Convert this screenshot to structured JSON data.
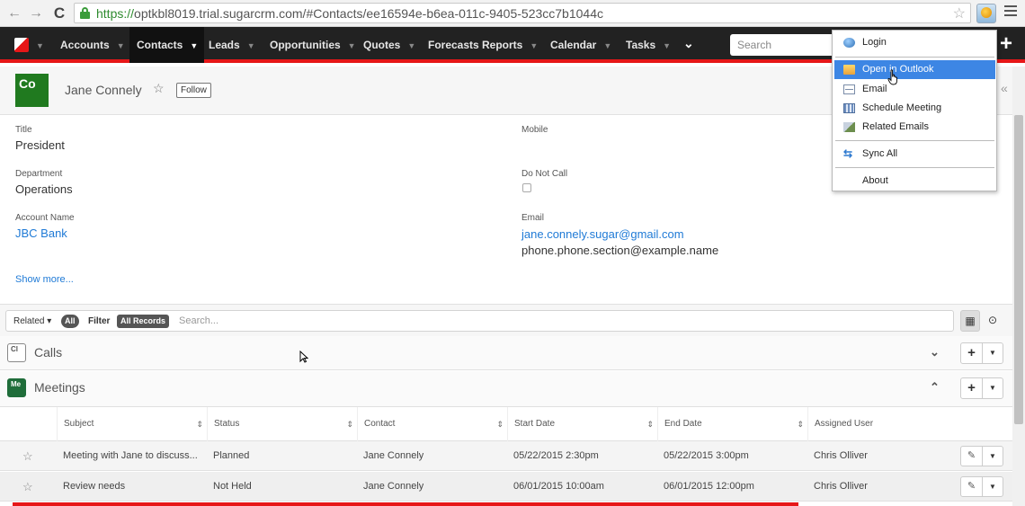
{
  "browser": {
    "url_scheme": "https://",
    "url_rest": "optkbl8019.trial.sugarcrm.com/#Contacts/ee16594e-b6ea-011c-9405-523cc7b1044c",
    "back_glyph": "←",
    "forward_glyph": "→",
    "reload_glyph": "C",
    "star_glyph": "☆"
  },
  "nav": {
    "items": [
      {
        "label": "Accounts"
      },
      {
        "label": "Contacts"
      },
      {
        "label": "Leads"
      },
      {
        "label": "Opportunities"
      },
      {
        "label": "Quotes"
      },
      {
        "label": "Forecasts"
      },
      {
        "label": "Reports"
      },
      {
        "label": "Calendar"
      },
      {
        "label": "Tasks"
      }
    ],
    "caret": "▼",
    "more": "⌄",
    "search_placeholder": "Search",
    "plus": "+"
  },
  "record": {
    "avatar": "Co",
    "name": "Jane Connely",
    "star": "☆",
    "follow": "Follow",
    "collapse": "«"
  },
  "fields": {
    "title_label": "Title",
    "title_value": "President",
    "mobile_label": "Mobile",
    "department_label": "Department",
    "department_value": "Operations",
    "dnc_label": "Do Not Call",
    "account_label": "Account Name",
    "account_value": "JBC Bank",
    "email_label": "Email",
    "email_primary": "jane.connely.sugar@gmail.com",
    "email_secondary": "phone.phone.section@example.name",
    "show_more": "Show more..."
  },
  "filter": {
    "related": "Related",
    "related_caret": "▾",
    "all": "All",
    "filter_label": "Filter",
    "all_records": "All Records",
    "search_placeholder": "Search...",
    "list_view_glyph": "▦",
    "activity_view_glyph": "⊙"
  },
  "subpanels": {
    "calls": {
      "icon": "Cl",
      "title": "Calls",
      "chevron": "⌄"
    },
    "meetings": {
      "icon": "Me",
      "title": "Meetings",
      "chevron": "⌃"
    },
    "add": "+",
    "dd": "▼"
  },
  "table": {
    "columns": [
      "Subject",
      "Status",
      "Contact",
      "Start Date",
      "End Date",
      "Assigned User"
    ],
    "sort_glyph": "⇕",
    "rows": [
      {
        "star": "☆",
        "subject": "Meeting with Jane to discuss...",
        "status": "Planned",
        "contact": "Jane Connely",
        "start": "05/22/2015 2:30pm",
        "end": "05/22/2015 3:00pm",
        "user": "Chris Olliver"
      },
      {
        "star": "☆",
        "subject": "Review needs",
        "status": "Not Held",
        "contact": "Jane Connely",
        "start": "06/01/2015 10:00am",
        "end": "06/01/2015 12:00pm",
        "user": "Chris Olliver"
      }
    ],
    "edit_glyph": "✎",
    "dd_glyph": "▼"
  },
  "dropdown": {
    "login": "Login",
    "open_in_outlook": "Open in Outlook",
    "email": "Email",
    "schedule_meeting": "Schedule Meeting",
    "related_emails": "Related Emails",
    "sync_all": "Sync All",
    "sync_glyph": "⇆",
    "about": "About"
  },
  "colors": {
    "accent_red": "#e61718",
    "link_blue": "#1f7ad6",
    "menu_highlight": "#3d86e4",
    "avatar_green": "#207a1f"
  }
}
